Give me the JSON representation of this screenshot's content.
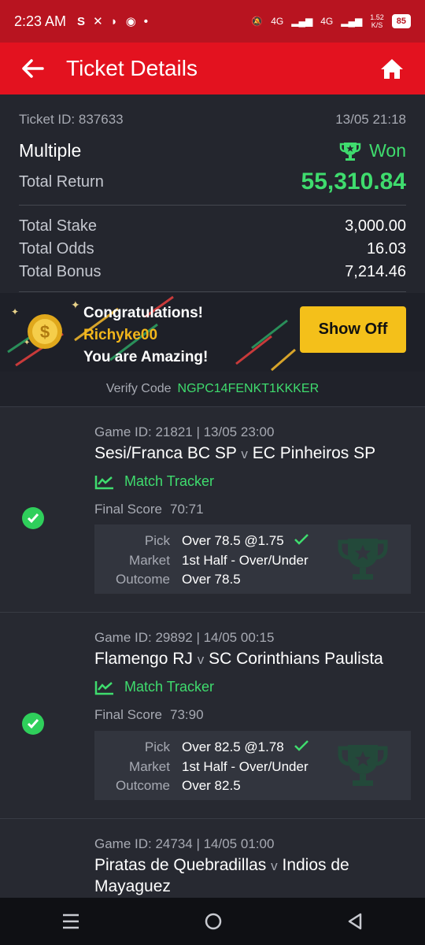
{
  "status_bar": {
    "time": "2:23 AM",
    "net1": "4G",
    "net2": "4G",
    "speed": "1.52",
    "speed_unit": "K/S",
    "battery": "85"
  },
  "header": {
    "title": "Ticket Details"
  },
  "ticket": {
    "id_text": "Ticket ID: 837633",
    "datetime": "13/05 21:18",
    "type": "Multiple",
    "status": "Won",
    "total_return_label": "Total Return",
    "total_return": "55,310.84",
    "stake_label": "Total Stake",
    "stake": "3,000.00",
    "odds_label": "Total Odds",
    "odds": "16.03",
    "bonus_label": "Total Bonus",
    "bonus": "7,214.46"
  },
  "banner": {
    "line1": "Congratulations!",
    "username": "Richyke00",
    "line3": "You are Amazing!",
    "button": "Show Off"
  },
  "verify": {
    "label": "Verify Code",
    "code": "NGPC14FENKT1KKKER"
  },
  "labels": {
    "match_tracker": "Match Tracker",
    "final_score": "Final Score",
    "pick": "Pick",
    "market": "Market",
    "outcome": "Outcome",
    "vs": "v"
  },
  "games": [
    {
      "id_line": "Game ID: 21821 | 13/05 23:00",
      "home": "Sesi/Franca BC SP",
      "away": "EC Pinheiros SP",
      "score": "70:71",
      "pick": "Over 78.5 @1.75",
      "market": "1st Half - Over/Under",
      "outcome": "Over 78.5"
    },
    {
      "id_line": "Game ID: 29892 | 14/05 00:15",
      "home": "Flamengo RJ",
      "away": "SC Corinthians Paulista",
      "score": "73:90",
      "pick": "Over 82.5 @1.78",
      "market": "1st Half - Over/Under",
      "outcome": "Over 82.5"
    },
    {
      "id_line": "Game ID: 24734 | 14/05 01:00",
      "home": "Piratas de Quebradillas",
      "away": "Indios de Mayaguez"
    }
  ]
}
